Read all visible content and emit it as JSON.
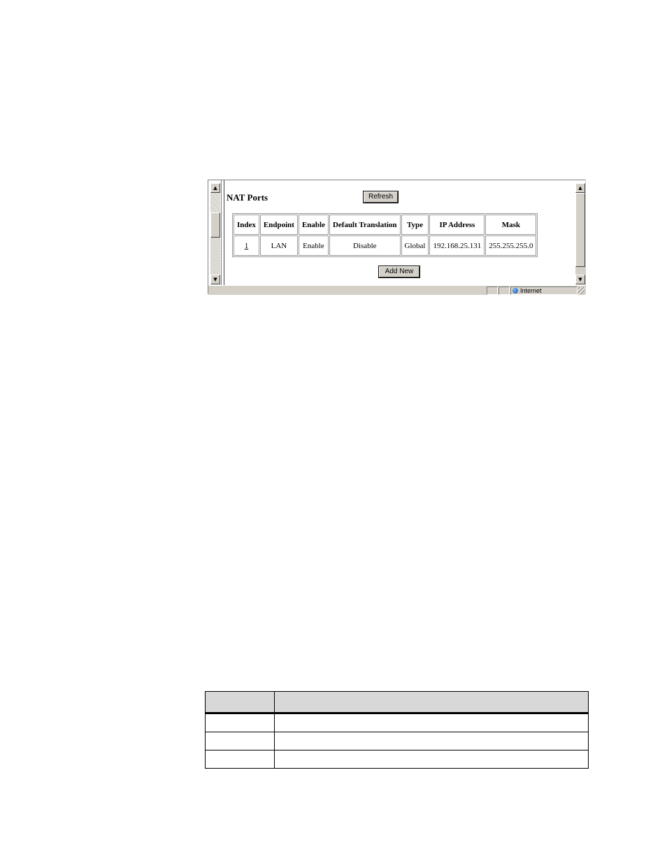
{
  "window": {
    "title": "NAT Ports",
    "buttons": {
      "refresh": "Refresh",
      "add_new": "Add New"
    },
    "table": {
      "headers": [
        "Index",
        "Endpoint",
        "Enable",
        "Default Translation",
        "Type",
        "IP Address",
        "Mask"
      ],
      "rows": [
        {
          "index": "1",
          "endpoint": "LAN",
          "enable": "Enable",
          "default_translation": "Disable",
          "type": "Global",
          "ip_address": "192.168.25.131",
          "mask": "255.255.255.0"
        }
      ]
    },
    "statusbar": {
      "zone": "Internet",
      "zone_icon": "globe-icon"
    },
    "scrollbar_glyphs": {
      "up": "▲",
      "down": "▼"
    }
  },
  "doc_table": {
    "headers": [
      "",
      ""
    ],
    "rows": [
      [
        "",
        ""
      ],
      [
        "",
        ""
      ],
      [
        "",
        ""
      ]
    ]
  }
}
